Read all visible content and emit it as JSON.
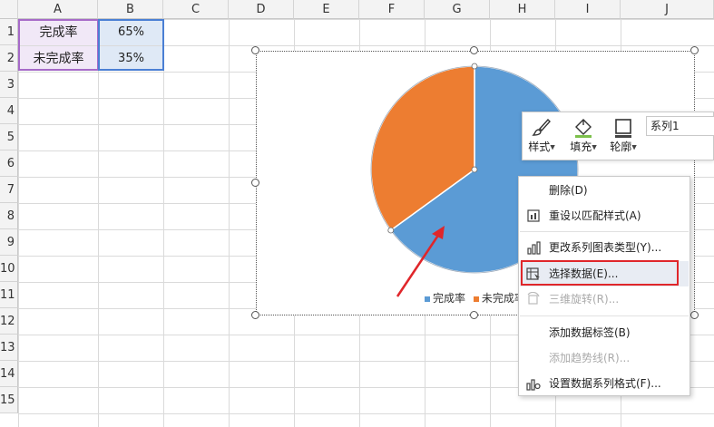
{
  "sheet": {
    "columns": [
      "A",
      "B",
      "C",
      "D",
      "E",
      "F",
      "G",
      "H",
      "I",
      "J"
    ],
    "rows": [
      "1",
      "2",
      "3",
      "4",
      "5",
      "6",
      "7",
      "8",
      "9",
      "10",
      "11",
      "12",
      "13",
      "14",
      "15"
    ],
    "cells": {
      "a1": "完成率",
      "b1": "65%",
      "a2": "未完成率",
      "b2": "35%"
    }
  },
  "chart": {
    "type": "pie",
    "chart_data": {
      "type": "pie",
      "categories": [
        "完成率",
        "未完成率"
      ],
      "values": [
        65,
        35
      ],
      "colors": [
        "#5b9bd5",
        "#ed7d31"
      ]
    },
    "legend": {
      "items": [
        "完成率",
        "未完成率"
      ]
    }
  },
  "mini_toolbar": {
    "style_label": "样式",
    "fill_label": "填充",
    "outline_label": "轮廓",
    "series_value": "系列1"
  },
  "context_menu": {
    "items": [
      {
        "label": "删除(D)",
        "enabled": true
      },
      {
        "label": "重设以匹配样式(A)",
        "enabled": true
      },
      {
        "label": "更改系列图表类型(Y)...",
        "enabled": true
      },
      {
        "label": "选择数据(E)...",
        "enabled": true
      },
      {
        "label": "三维旋转(R)...",
        "enabled": false
      },
      {
        "label": "添加数据标签(B)",
        "enabled": true
      },
      {
        "label": "添加趋势线(R)...",
        "enabled": false
      },
      {
        "label": "设置数据系列格式(F)...",
        "enabled": true
      }
    ]
  },
  "colors": {
    "highlight_box": "#e0262a",
    "arrow": "#e0262a",
    "pie_blue": "#5b9bd5",
    "pie_orange": "#ed7d31"
  }
}
